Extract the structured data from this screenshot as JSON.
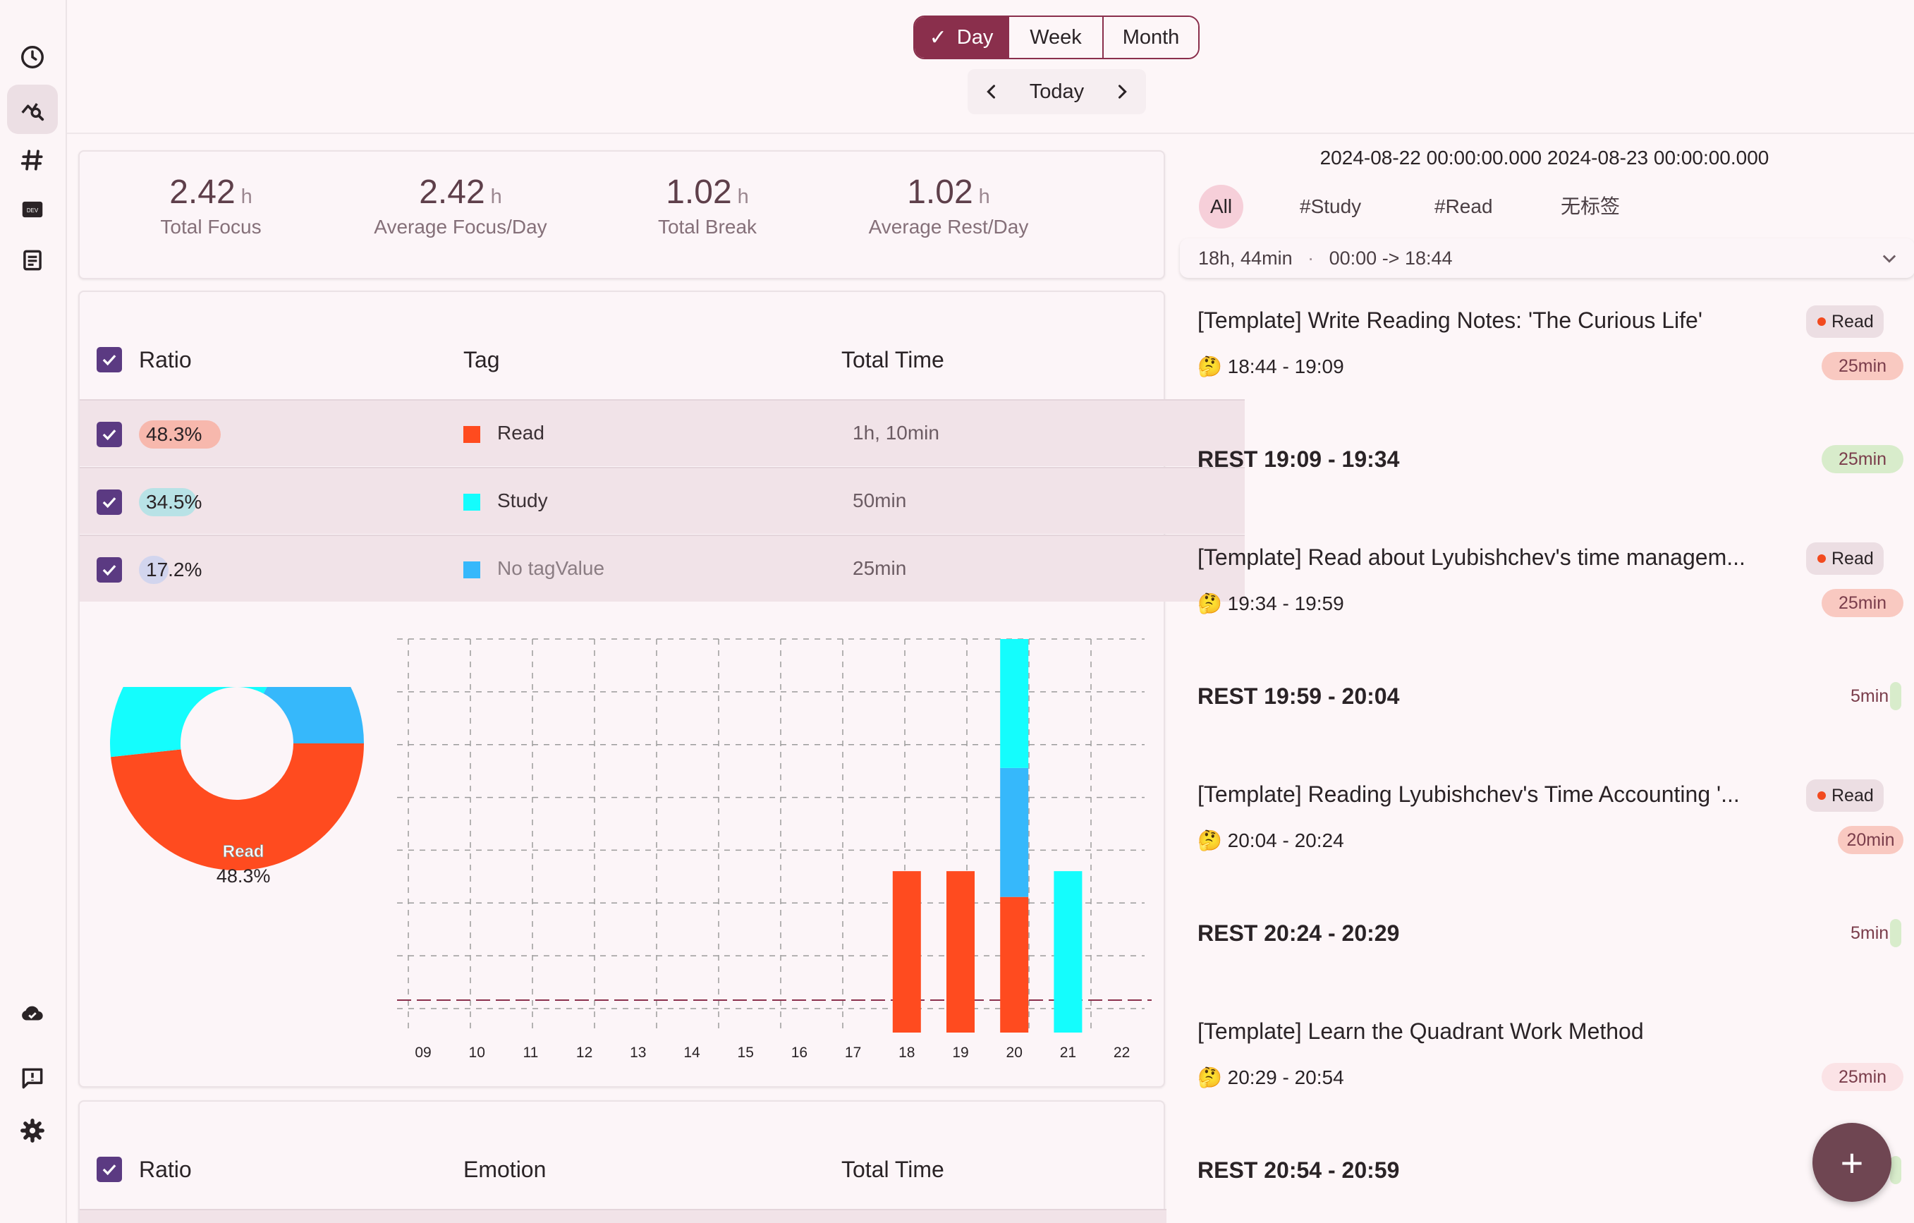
{
  "period_tabs": {
    "day": "Day",
    "week": "Week",
    "month": "Month",
    "selected": "Day"
  },
  "nav": {
    "label": "Today"
  },
  "stats": [
    {
      "value": "2.42",
      "unit": "h",
      "label": "Total Focus"
    },
    {
      "value": "2.42",
      "unit": "h",
      "label": "Average Focus/Day"
    },
    {
      "value": "1.02",
      "unit": "h",
      "label": "Total Break"
    },
    {
      "value": "1.02",
      "unit": "h",
      "label": "Average Rest/Day"
    }
  ],
  "tag_table": {
    "headers": {
      "ratio": "Ratio",
      "tag": "Tag",
      "total": "Total Time"
    },
    "rows": [
      {
        "pct": "48.3%",
        "tag": "Read",
        "total": "1h, 10min",
        "color": "#ff4b1f",
        "pill_color": "#f7b8ad",
        "fraction": 0.483
      },
      {
        "pct": "34.5%",
        "tag": "Study",
        "total": "50min",
        "color": "#14fdfd",
        "pill_color": "#b8e2e6",
        "fraction": 0.345
      },
      {
        "pct": "17.2%",
        "tag": "No tagValue",
        "total": "25min",
        "color": "#36b8fb",
        "pill_color": "#d2d5ee",
        "fraction": 0.172
      }
    ]
  },
  "emotion_table": {
    "headers": {
      "ratio": "Ratio",
      "emotion": "Emotion",
      "total": "Total Time"
    }
  },
  "chart_data": [
    {
      "type": "pie",
      "donut": true,
      "slices": [
        {
          "label": "Read",
          "value": 48.3,
          "color": "#ff4b1f",
          "pct_label": "48.3%"
        },
        {
          "label": "Study",
          "value": 34.5,
          "color": "#14fdfd",
          "pct_label": "34.5%"
        },
        {
          "label": "",
          "value": 17.2,
          "color": "#36b8fb",
          "pct_label": "17.2%"
        }
      ]
    },
    {
      "type": "bar",
      "stacked": true,
      "categories": [
        "09",
        "10",
        "11",
        "12",
        "13",
        "14",
        "15",
        "16",
        "17",
        "18",
        "19",
        "20",
        "21",
        "22"
      ],
      "series": [
        {
          "name": "Read",
          "color": "#ff4b1f",
          "values": [
            0,
            0,
            0,
            0,
            0,
            0,
            0,
            0,
            0,
            25,
            25,
            20,
            0,
            0
          ]
        },
        {
          "name": "No tagValue",
          "color": "#36b8fb",
          "values": [
            0,
            0,
            0,
            0,
            0,
            0,
            0,
            0,
            0,
            0,
            0,
            25,
            0,
            0
          ]
        },
        {
          "name": "Study",
          "color": "#14fdfd",
          "values": [
            0,
            0,
            0,
            0,
            0,
            0,
            0,
            0,
            0,
            0,
            0,
            25,
            25,
            0
          ]
        }
      ],
      "ylim": [
        0,
        70
      ],
      "grid": true
    }
  ],
  "right": {
    "date_range": "2024-08-22 00:00:00.000 2024-08-23 00:00:00.000",
    "filters": [
      "All",
      "#Study",
      "#Read",
      "无标签"
    ],
    "summary": {
      "duration": "18h, 44min",
      "sep": "·",
      "span": "00:00 -> 18:44"
    },
    "entries": [
      {
        "kind": "focus",
        "title": "[Template] Write Reading Notes: 'The Curious Life'",
        "tag": "Read",
        "emoji": "🤔",
        "time": "18:44 - 19:09",
        "dur": "25min"
      },
      {
        "kind": "rest",
        "title": "REST 19:09 - 19:34",
        "dur": "25min"
      },
      {
        "kind": "focus",
        "title": "[Template] Read about Lyubishchev's time managem...",
        "tag": "Read",
        "emoji": "🤔",
        "time": "19:34 - 19:59",
        "dur": "25min"
      },
      {
        "kind": "rest",
        "title": "REST 19:59 - 20:04",
        "dur": "5min"
      },
      {
        "kind": "focus",
        "title": "[Template] Reading Lyubishchev's Time Accounting '...",
        "tag": "Read",
        "emoji": "🤔",
        "time": "20:04 - 20:24",
        "dur": "20min"
      },
      {
        "kind": "rest",
        "title": "REST 20:24 - 20:29",
        "dur": "5min"
      },
      {
        "kind": "focus",
        "title": "[Template] Learn the Quadrant Work Method",
        "emoji": "🤔",
        "time": "20:29 - 20:54",
        "dur": "25min"
      },
      {
        "kind": "rest",
        "title": "REST 20:54 - 20:59",
        "dur": ""
      }
    ]
  },
  "fab": {
    "label": "+"
  },
  "colors": {
    "accent": "#8a2f4c",
    "checkbox": "#5b3a82"
  }
}
